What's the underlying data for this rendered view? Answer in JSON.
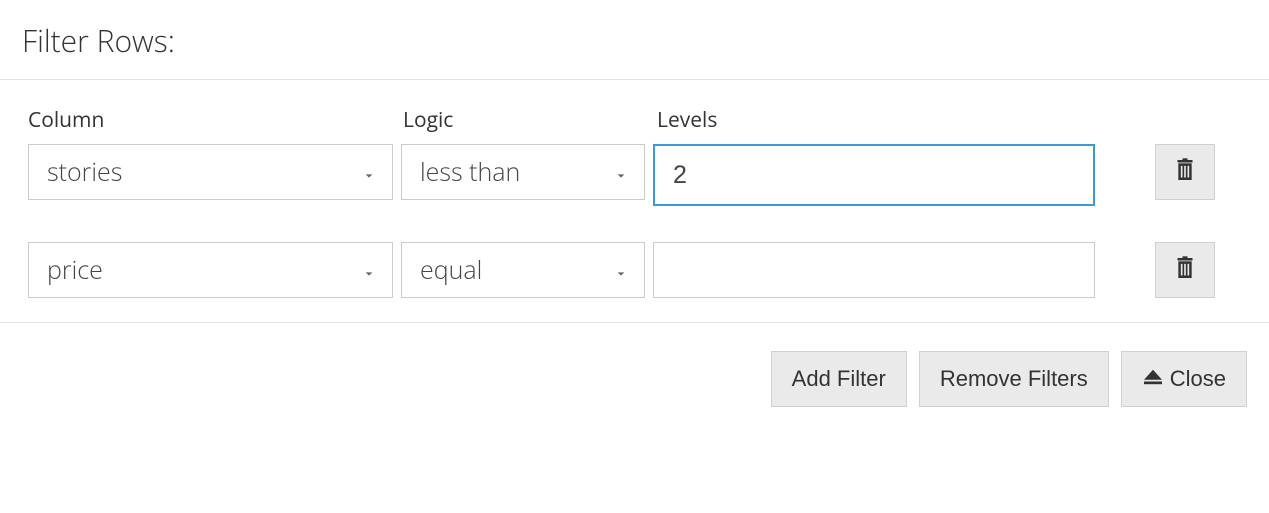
{
  "title": "Filter Rows:",
  "headers": {
    "column": "Column",
    "logic": "Logic",
    "levels": "Levels"
  },
  "rows": [
    {
      "column_value": "stories",
      "logic_value": "less than",
      "levels_value": "2",
      "focused": true
    },
    {
      "column_value": "price",
      "logic_value": "equal",
      "levels_value": "",
      "focused": false
    }
  ],
  "buttons": {
    "add_filter": "Add Filter",
    "remove_filters": "Remove Filters",
    "close": "Close"
  }
}
